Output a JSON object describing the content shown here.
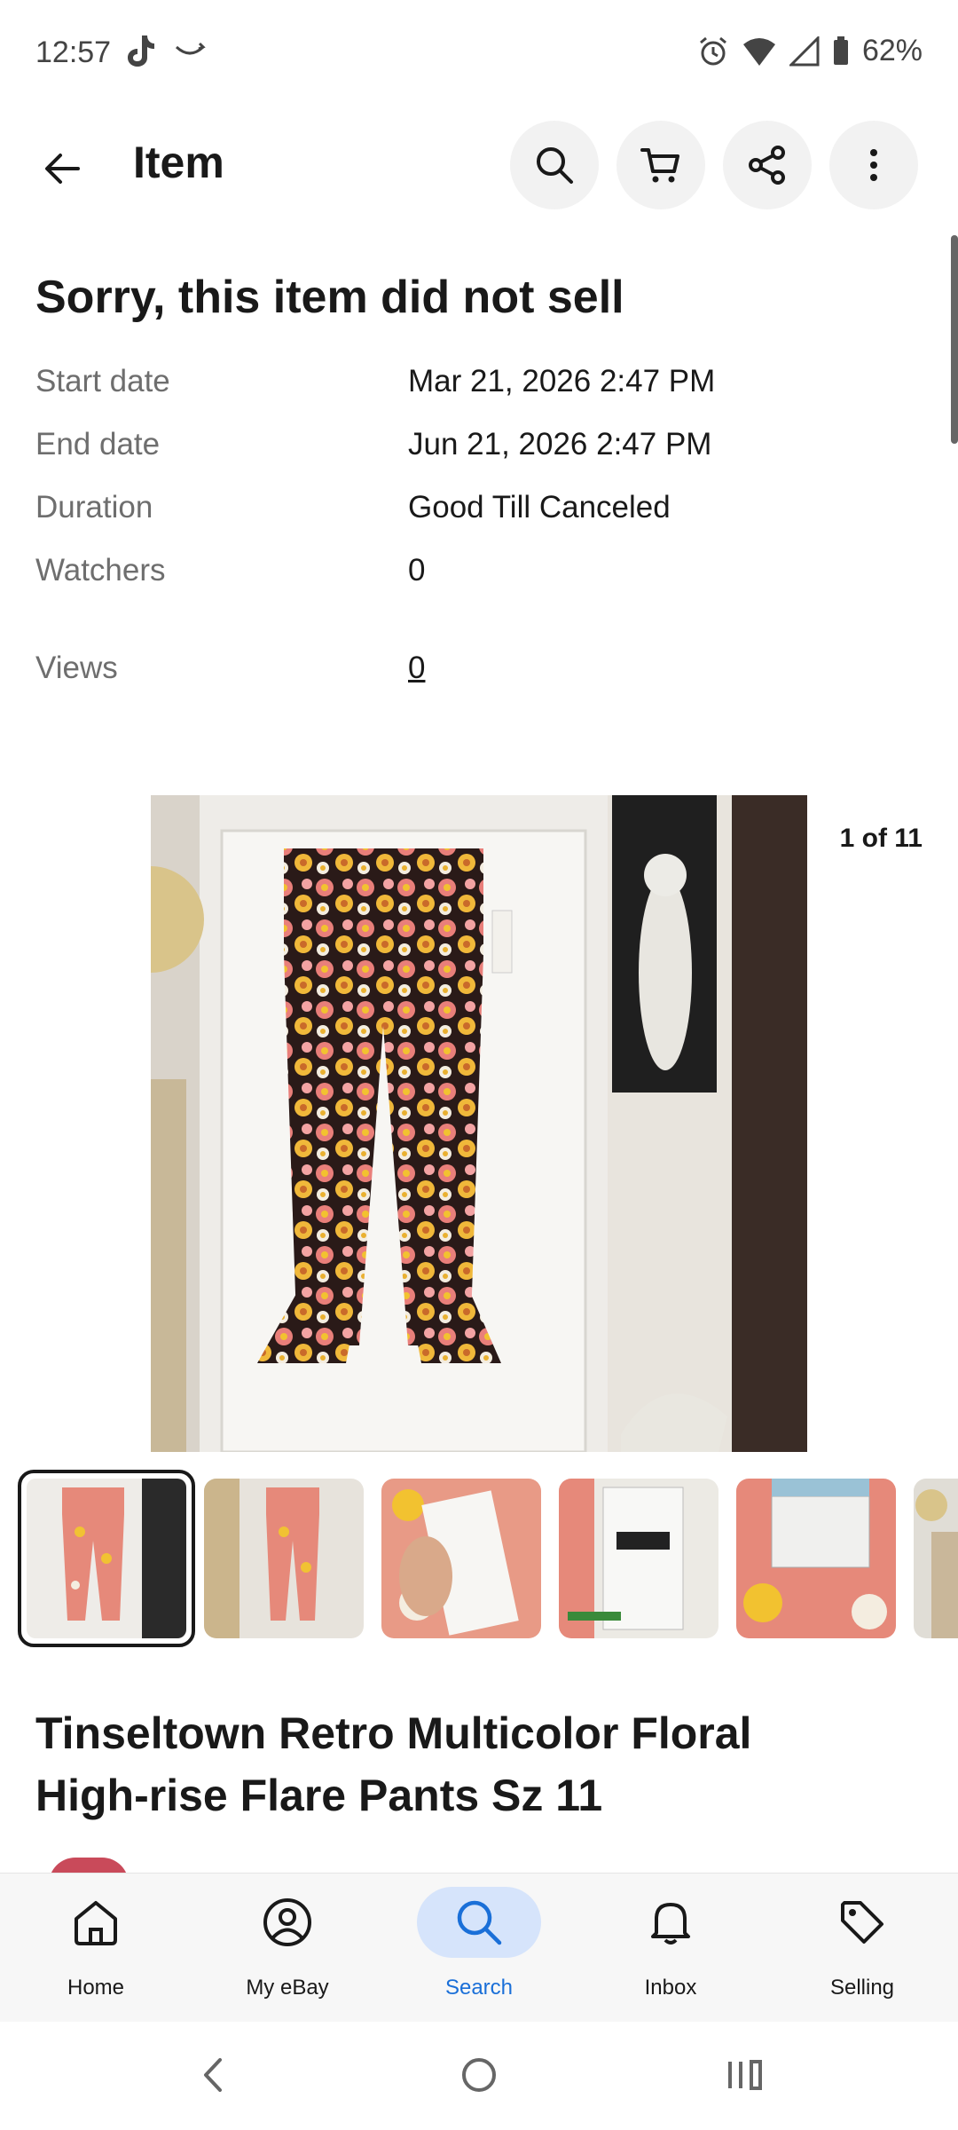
{
  "status_bar": {
    "time": "12:57",
    "battery": "62%"
  },
  "app_bar": {
    "title": "Item"
  },
  "listing_status": {
    "headline": "Sorry, this item did not sell"
  },
  "details": [
    {
      "label": "Start date",
      "value": "Mar 21, 2026 2:47 PM"
    },
    {
      "label": "End date",
      "value": "Jun 21, 2026 2:47 PM"
    },
    {
      "label": "Duration",
      "value": "Good Till Canceled"
    },
    {
      "label": "Watchers",
      "value": "0"
    },
    {
      "label": "Views",
      "value": "0"
    }
  ],
  "gallery": {
    "counter": "1 of 11",
    "thumbnail_count_visible": 6
  },
  "item": {
    "title_line1": "Tinseltown Retro Multicolor Floral",
    "title_line2": "High-rise Flare Pants Sz 11"
  },
  "bottom_nav": [
    {
      "label": "Home",
      "icon": "home-icon"
    },
    {
      "label": "My eBay",
      "icon": "account-icon"
    },
    {
      "label": "Search",
      "icon": "search-icon",
      "active": true
    },
    {
      "label": "Inbox",
      "icon": "bell-icon"
    },
    {
      "label": "Selling",
      "icon": "tag-icon"
    }
  ],
  "colors": {
    "accent": "#1a6fd8",
    "active_pill": "#d6e4fb",
    "text": "#191919",
    "muted": "#6e6e6e"
  }
}
